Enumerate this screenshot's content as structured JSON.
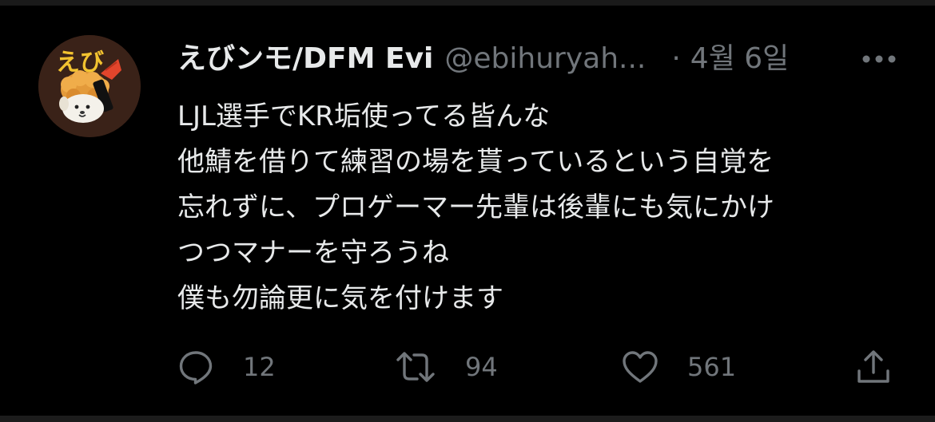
{
  "tweet": {
    "author": {
      "display_name": "えびンモ/DFM Evi",
      "handle": "@ebihuryah...",
      "avatar_text": "えび"
    },
    "separator": "·",
    "date": "4월 6일",
    "text_lines": [
      "LJL選手でKR垢使ってる皆んな",
      "他鯖を借りて練習の場を貰っているという自覚を",
      "忘れずに、プロゲーマー先輩は後輩にも気にかけ",
      "つつマナーを守ろうね",
      "僕も勿論更に気を付けます"
    ],
    "actions": {
      "reply_count": "12",
      "retweet_count": "94",
      "like_count": "561"
    },
    "icons": {
      "more": "more-horizontal-icon",
      "reply": "reply-icon",
      "retweet": "retweet-icon",
      "like": "heart-icon",
      "share": "share-icon"
    }
  },
  "theme": {
    "background": "#000000",
    "text_primary": "#e7e9ea",
    "text_secondary": "#71767b",
    "avatar_text": "#f2c230"
  }
}
